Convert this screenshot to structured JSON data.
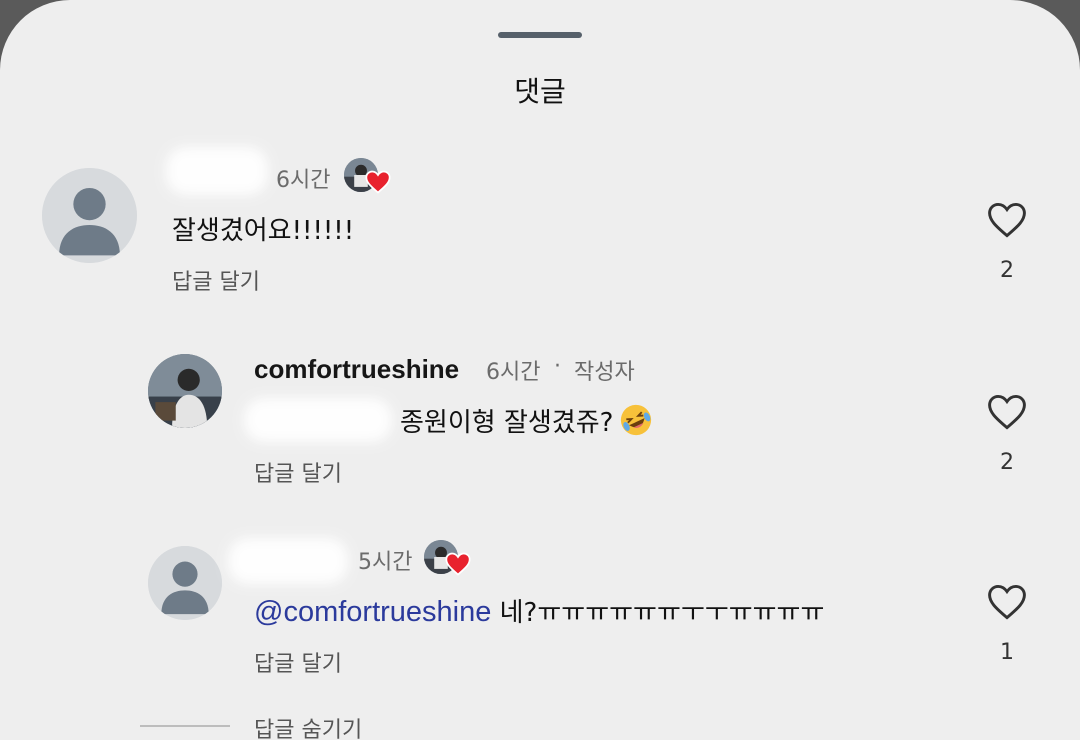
{
  "sheet": {
    "title": "댓글"
  },
  "comments": [
    {
      "username": "",
      "time": "6시간",
      "text": "잘생겼어요!!!!!!",
      "reply_label": "답글 달기",
      "likes": "2",
      "liked_by_author": true
    },
    {
      "username": "comfortrueshine",
      "time": "6시간",
      "separator": "·",
      "author_badge": "작성자",
      "text": "종원이형 잘생겼쥬?",
      "emoji": "rolling-on-floor-laughing-emoji",
      "reply_label": "답글 달기",
      "likes": "2"
    },
    {
      "username": "",
      "time": "5시간",
      "mention": "@comfortrueshine",
      "text": "네?ㅠㅠㅠㅠㅠㅠㅜㅜㅠㅠㅠㅠ",
      "reply_label": "답글 달기",
      "likes": "1",
      "liked_by_author": true
    }
  ],
  "thread": {
    "hide_replies_label": "답글 숨기기"
  },
  "colors": {
    "sheet_bg": "#eeeeee",
    "mention": "#2b3a9c",
    "heart_red": "#e8222e"
  }
}
